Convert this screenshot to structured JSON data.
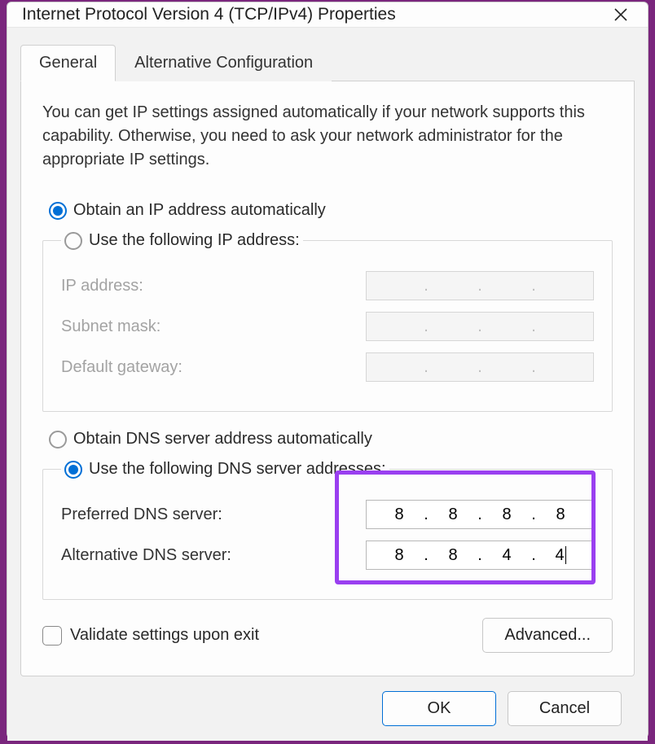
{
  "window": {
    "title": "Internet Protocol Version 4 (TCP/IPv4) Properties"
  },
  "tabs": {
    "general": "General",
    "alt": "Alternative Configuration"
  },
  "intro": "You can get IP settings assigned automatically if your network supports this capability. Otherwise, you need to ask your network administrator for the appropriate IP settings.",
  "ip_section": {
    "auto_label": "Obtain an IP address automatically",
    "auto_selected": true,
    "manual_label": "Use the following IP address:",
    "manual_selected": false,
    "fields": {
      "ip_label": "IP address:",
      "ip_value": "",
      "subnet_label": "Subnet mask:",
      "subnet_value": "",
      "gateway_label": "Default gateway:",
      "gateway_value": ""
    }
  },
  "dns_section": {
    "auto_label": "Obtain DNS server address automatically",
    "auto_selected": false,
    "manual_label": "Use the following DNS server addresses:",
    "manual_selected": true,
    "fields": {
      "preferred_label": "Preferred DNS server:",
      "preferred_value": [
        "8",
        "8",
        "8",
        "8"
      ],
      "alt_label": "Alternative DNS server:",
      "alt_value": [
        "8",
        "8",
        "4",
        "4"
      ]
    }
  },
  "validate_label": "Validate settings upon exit",
  "validate_checked": false,
  "buttons": {
    "advanced": "Advanced...",
    "ok": "OK",
    "cancel": "Cancel"
  },
  "colors": {
    "accent_blue": "#006fd6",
    "highlight_purple": "#9a3ff0",
    "window_bg_purple": "#7a267d"
  }
}
